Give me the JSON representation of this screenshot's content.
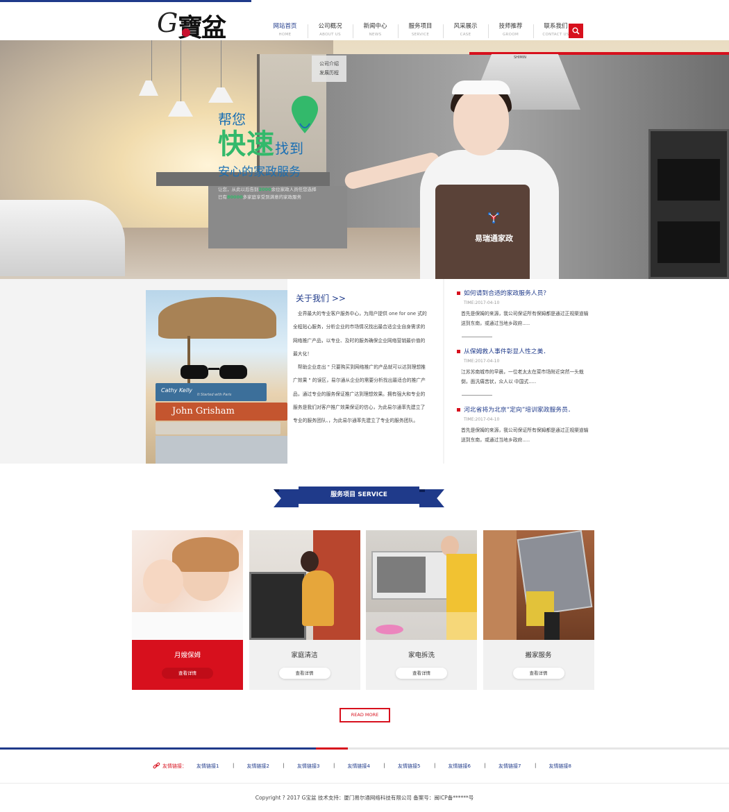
{
  "header": {
    "logo_text": "G寶盆",
    "nav": [
      {
        "cn": "网站首页",
        "en": "HOME"
      },
      {
        "cn": "公司概况",
        "en": "ABOUT US"
      },
      {
        "cn": "新闻中心",
        "en": "NEWS"
      },
      {
        "cn": "服务项目",
        "en": "SERVICE"
      },
      {
        "cn": "风采展示",
        "en": "CASE"
      },
      {
        "cn": "技师推荐",
        "en": "GROOM"
      },
      {
        "cn": "联系我们",
        "en": "CONTACT US"
      }
    ],
    "submenu": [
      "公司介绍",
      "发展历程"
    ]
  },
  "banner": {
    "line1": "帮您",
    "line2_big": "快速",
    "line2_small": "找到",
    "line3": "安心的家政服务",
    "line4a_pre": "让您，从此以后告别",
    "line4a_hl": "2000",
    "line4a_post": "余位家政人员任您选择",
    "line4b_pre": "已有",
    "line4b_hl": "80000",
    "line4b_post": "多家庭享受到满意的家政服务",
    "brand": "易瑞通家政",
    "hood_brand": "SHIMIN"
  },
  "about": {
    "title": "关于我们 >>",
    "p1": "业界最大的专业客户服务中心，为用户提供 one for one 式的全程贴心服务，分析企业的市场情况找出最合适企业自身需求的网络推广产品，以专业、及时的服务确保企业网络营销最价值的最大化！",
    "p2": "帮助企业走出 \" 只要购买到网络推广的产品就可以达到理想推广效果 \" 的误区，易尔通从企业的需要分析找出最适合的推广产品，通过专业的服务保证推广达到理想效果。拥有强大和专业的服务是我们对客户推广效果保证的信心，为此易尔通率先建立了专业的服务团队、，为此易尔通率先建立了专业的服务团队。",
    "book_titles": [
      "Cathy Kelly",
      "It Started with Paris",
      "John Grisham"
    ]
  },
  "news": [
    {
      "title": "如何请到合适的家政服务人员？",
      "time": "TIME:2017-04-10",
      "desc": "首先是保姆的来源，我公司保证所有保姆都是通过正规渠道输送到东南，或通过当地乡政府....."
    },
    {
      "title": "从保姆救人事件彰显人性之美．",
      "time": "TIME:2017-04-10",
      "desc": "江苏苏南城市的早晨，一位老太太在菜市场附近突然一头栽倒，面汎痛苦状，众人以 中国式....."
    },
    {
      "title": "河北省将为北京“定向”培训家政服务员．",
      "time": "TIME:2017-04-10",
      "desc": "首先是保姆的来源，我公司保证所有保姆都是通过正规渠道输送到东南，或通过当地乡政府....."
    }
  ],
  "services": {
    "title": "服务项目  SERVICE",
    "items": [
      {
        "label": "月嫂保姆",
        "more": "查看详情"
      },
      {
        "label": "家庭清洁",
        "more": "查看详情"
      },
      {
        "label": "家电拆洗",
        "more": "查看详情"
      },
      {
        "label": "搬家服务",
        "more": "查看详情"
      }
    ],
    "read_more": "READ MORE"
  },
  "footer": {
    "links_title": "友情链接：",
    "links": [
      "友情链接1",
      "友情链接2",
      "友情链接3",
      "友情链接4",
      "友情链接5",
      "友情链接6",
      "友情链接7",
      "友情链接8"
    ],
    "copyright": "Copyright ? 2017 G宝盆 技术支持：厦门易尔通网络科技有限公司  备案号：闽ICP备******号"
  },
  "colors": {
    "brand_blue": "#1f3a8a",
    "brand_red": "#d7101d",
    "green": "#33b96b"
  },
  "icons": {
    "search": "search-icon",
    "link": "link-icon",
    "pin": "map-pin-icon"
  }
}
